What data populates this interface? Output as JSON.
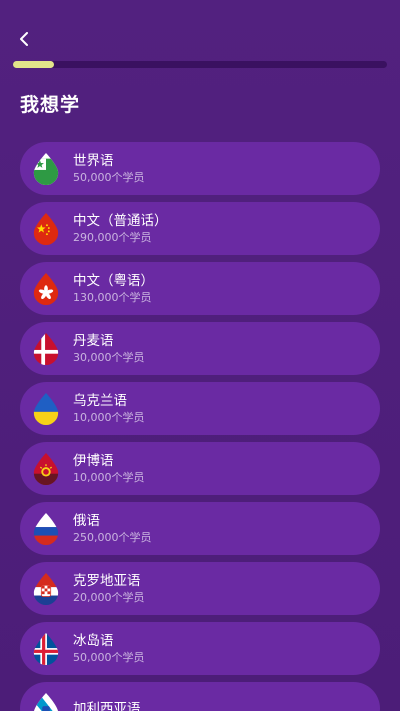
{
  "header": {
    "back_icon": "chevron-left-icon",
    "progress": 0.11
  },
  "page": {
    "title": "我想学"
  },
  "colors": {
    "background": "#4f1f7a",
    "card": "#6a2aa3",
    "progress_fill": "#e3e48a",
    "progress_track": "#3a1160",
    "subtext": "#c9b3df"
  },
  "languages": [
    {
      "name": "世界语",
      "learners": "50,000个学员",
      "flag": "esperanto-flag-icon"
    },
    {
      "name": "中文（普通话）",
      "learners": "290,000个学员",
      "flag": "china-flag-icon"
    },
    {
      "name": "中文（粤语）",
      "learners": "130,000个学员",
      "flag": "hong-kong-flag-icon"
    },
    {
      "name": "丹麦语",
      "learners": "30,000个学员",
      "flag": "denmark-flag-icon"
    },
    {
      "name": "乌克兰语",
      "learners": "10,000个学员",
      "flag": "ukraine-flag-icon"
    },
    {
      "name": "伊博语",
      "learners": "10,000个学员",
      "flag": "igbo-flag-icon"
    },
    {
      "name": "俄语",
      "learners": "250,000个学员",
      "flag": "russia-flag-icon"
    },
    {
      "name": "克罗地亚语",
      "learners": "20,000个学员",
      "flag": "croatia-flag-icon"
    },
    {
      "name": "冰岛语",
      "learners": "50,000个学员",
      "flag": "iceland-flag-icon"
    },
    {
      "name": "加利西亚语",
      "learners": "",
      "flag": "galicia-flag-icon"
    }
  ]
}
